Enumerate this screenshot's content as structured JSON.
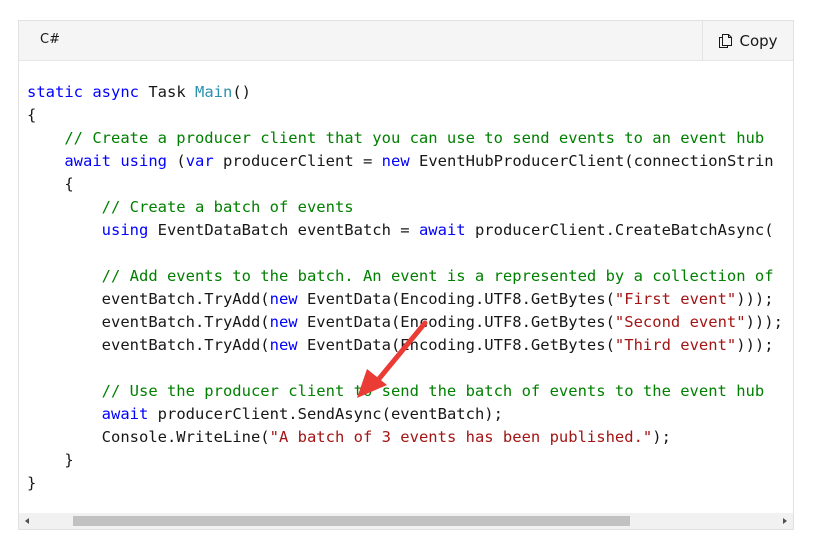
{
  "header": {
    "language": "C#",
    "copy_label": "Copy",
    "copy_icon": "copy-icon"
  },
  "colors": {
    "keyword": "#0101fd",
    "type": "#2b91af",
    "comment": "#008000",
    "string": "#a31515",
    "annotation_arrow": "#ea3b35"
  },
  "code": {
    "lines": [
      [
        {
          "t": "kw",
          "v": "static"
        },
        {
          "t": "pl",
          "v": " "
        },
        {
          "t": "kw",
          "v": "async"
        },
        {
          "t": "pl",
          "v": " Task "
        },
        {
          "t": "tp",
          "v": "Main"
        },
        {
          "t": "pl",
          "v": "()"
        }
      ],
      [
        {
          "t": "pl",
          "v": "{"
        }
      ],
      [
        {
          "t": "pl",
          "v": "    "
        },
        {
          "t": "cm",
          "v": "// Create a producer client that you can use to send events to an event hub"
        }
      ],
      [
        {
          "t": "pl",
          "v": "    "
        },
        {
          "t": "kw",
          "v": "await"
        },
        {
          "t": "pl",
          "v": " "
        },
        {
          "t": "kw",
          "v": "using"
        },
        {
          "t": "pl",
          "v": " ("
        },
        {
          "t": "kw",
          "v": "var"
        },
        {
          "t": "pl",
          "v": " producerClient = "
        },
        {
          "t": "kw",
          "v": "new"
        },
        {
          "t": "pl",
          "v": " EventHubProducerClient(connectionStrin"
        }
      ],
      [
        {
          "t": "pl",
          "v": "    {"
        }
      ],
      [
        {
          "t": "pl",
          "v": "        "
        },
        {
          "t": "cm",
          "v": "// Create a batch of events"
        }
      ],
      [
        {
          "t": "pl",
          "v": "        "
        },
        {
          "t": "kw",
          "v": "using"
        },
        {
          "t": "pl",
          "v": " EventDataBatch eventBatch = "
        },
        {
          "t": "kw",
          "v": "await"
        },
        {
          "t": "pl",
          "v": " producerClient.CreateBatchAsync("
        }
      ],
      [],
      [
        {
          "t": "pl",
          "v": "        "
        },
        {
          "t": "cm",
          "v": "// Add events to the batch. An event is a represented by a collection of"
        }
      ],
      [
        {
          "t": "pl",
          "v": "        eventBatch.TryAdd("
        },
        {
          "t": "kw",
          "v": "new"
        },
        {
          "t": "pl",
          "v": " EventData(Encoding.UTF8.GetBytes("
        },
        {
          "t": "st",
          "v": "\"First event\""
        },
        {
          "t": "pl",
          "v": ")));"
        }
      ],
      [
        {
          "t": "pl",
          "v": "        eventBatch.TryAdd("
        },
        {
          "t": "kw",
          "v": "new"
        },
        {
          "t": "pl",
          "v": " EventData(Encoding.UTF8.GetBytes("
        },
        {
          "t": "st",
          "v": "\"Second event\""
        },
        {
          "t": "pl",
          "v": ")));"
        }
      ],
      [
        {
          "t": "pl",
          "v": "        eventBatch.TryAdd("
        },
        {
          "t": "kw",
          "v": "new"
        },
        {
          "t": "pl",
          "v": " EventData(Encoding.UTF8.GetBytes("
        },
        {
          "t": "st",
          "v": "\"Third event\""
        },
        {
          "t": "pl",
          "v": ")));"
        }
      ],
      [],
      [
        {
          "t": "pl",
          "v": "        "
        },
        {
          "t": "cm",
          "v": "// Use the producer client to send the batch of events to the event hub"
        }
      ],
      [
        {
          "t": "pl",
          "v": "        "
        },
        {
          "t": "kw",
          "v": "await"
        },
        {
          "t": "pl",
          "v": " producerClient.SendAsync(eventBatch);"
        }
      ],
      [
        {
          "t": "pl",
          "v": "        Console.WriteLine("
        },
        {
          "t": "st",
          "v": "\"A batch of 3 events has been published.\""
        },
        {
          "t": "pl",
          "v": ");"
        }
      ],
      [
        {
          "t": "pl",
          "v": "    }"
        }
      ],
      [
        {
          "t": "pl",
          "v": "}"
        }
      ]
    ]
  },
  "scrollbar": {
    "left_arrow": "arrow-left-icon",
    "right_arrow": "arrow-right-icon"
  }
}
